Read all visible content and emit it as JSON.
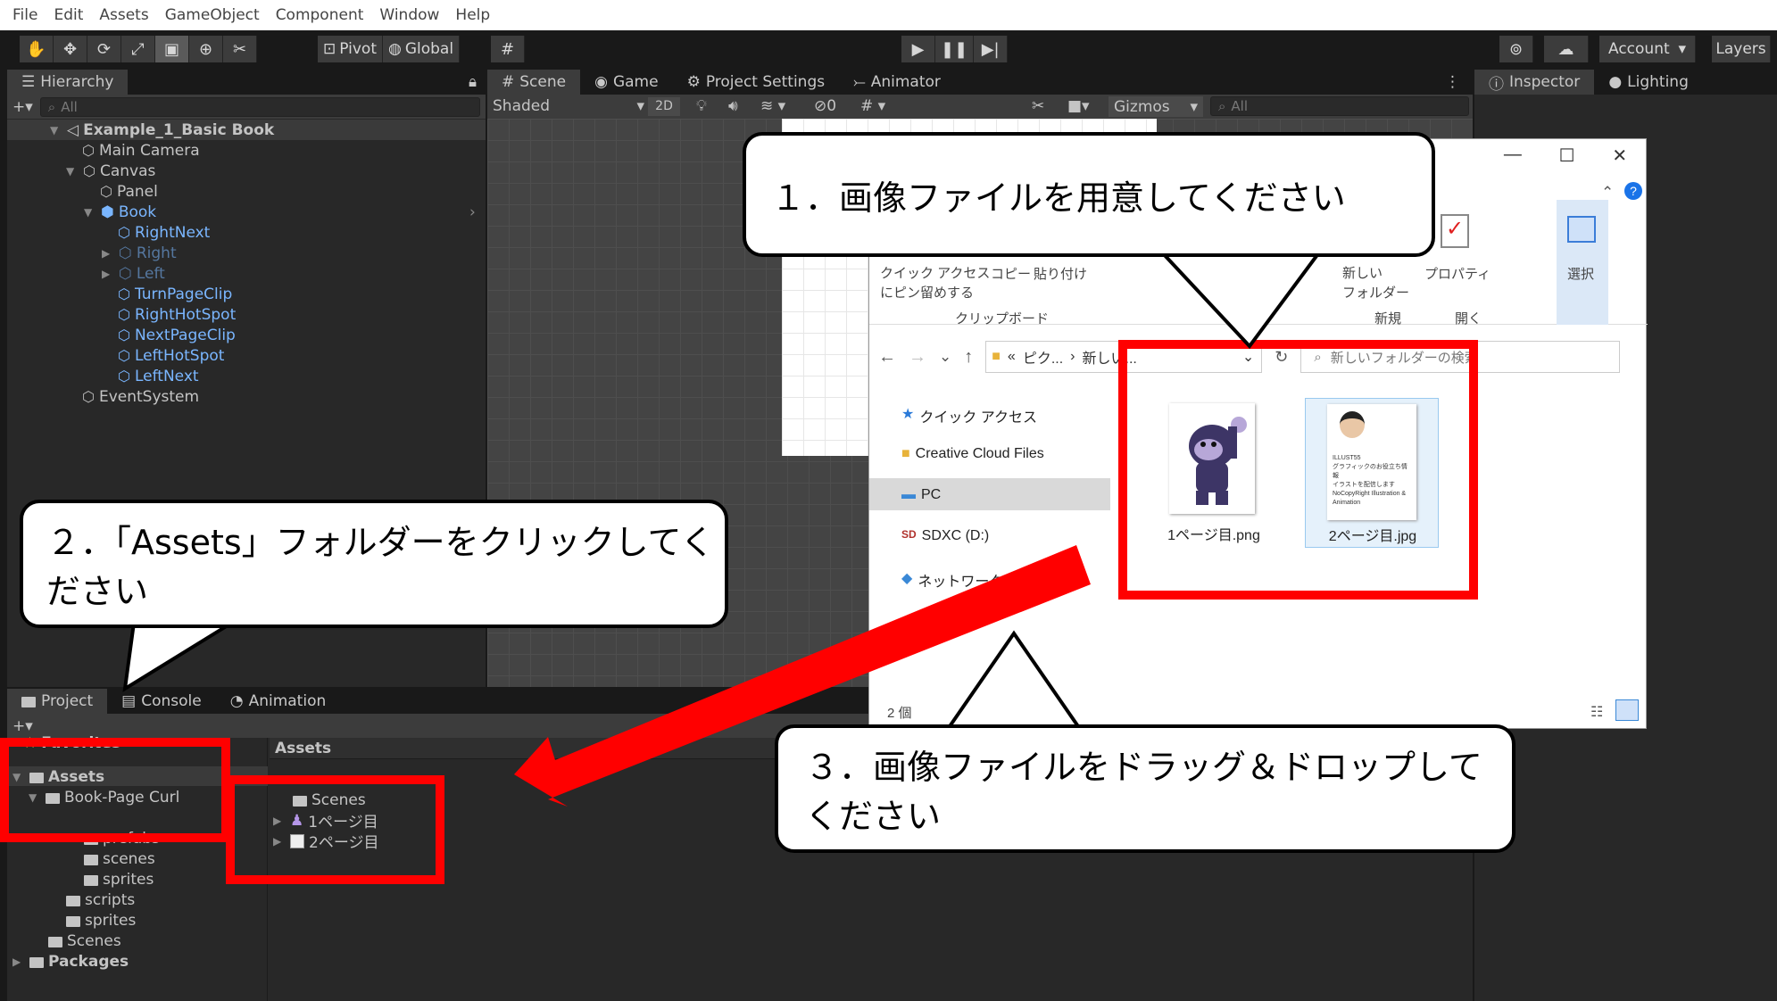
{
  "menu": [
    "File",
    "Edit",
    "Assets",
    "GameObject",
    "Component",
    "Window",
    "Help"
  ],
  "toolbar": {
    "pivot_label": "Pivot",
    "global_label": "Global",
    "account_label": "Account",
    "layers_label": "Layers"
  },
  "hierarchy": {
    "tab_label": "Hierarchy",
    "search_placeholder": "All",
    "scene_name": "Example_1_Basic Book",
    "items": [
      {
        "label": "Main Camera"
      },
      {
        "label": "Canvas"
      },
      {
        "label": "Panel"
      },
      {
        "label": "Book"
      },
      {
        "label": "RightNext"
      },
      {
        "label": "Right"
      },
      {
        "label": "Left"
      },
      {
        "label": "TurnPageClip"
      },
      {
        "label": "RightHotSpot"
      },
      {
        "label": "NextPageClip"
      },
      {
        "label": "LeftHotSpot"
      },
      {
        "label": "LeftNext"
      },
      {
        "label": "EventSystem"
      }
    ]
  },
  "scene": {
    "tabs": [
      "Scene",
      "Game",
      "Project Settings",
      "Animator"
    ],
    "shading_mode": "Shaded",
    "mode_2d": "2D",
    "hidden_count": "0",
    "gizmos_label": "Gizmos",
    "search_placeholder": "All"
  },
  "inspector": {
    "tabs": [
      "Inspector",
      "Lighting"
    ]
  },
  "project": {
    "tabs": [
      "Project",
      "Console",
      "Animation"
    ],
    "tree": [
      {
        "label": "Favorites"
      },
      {
        "label": "Assets"
      },
      {
        "label": "Book-Page Curl"
      },
      {
        "label": "prefabs"
      },
      {
        "label": "scenes"
      },
      {
        "label": "sprites"
      },
      {
        "label": "scripts"
      },
      {
        "label": "sprites"
      },
      {
        "label": "Scenes"
      },
      {
        "label": "Packages"
      }
    ],
    "assets_header": "Assets",
    "assets_items": [
      {
        "label": "Scenes"
      },
      {
        "label": "1ページ目"
      },
      {
        "label": "2ページ目"
      }
    ]
  },
  "explorer": {
    "ribbon": {
      "quick_access_line1": "クイック アクセス",
      "quick_access_line2": "にピン留めする",
      "copy": "コピー",
      "paste": "貼り付け",
      "clipboard_group": "クリップボード",
      "new_folder_line1": "新しい",
      "new_folder_line2": "フォルダー",
      "new_group": "新規",
      "properties": "プロパティ",
      "open_group": "開く",
      "select": "選択"
    },
    "address_prefix": "«",
    "address_seg1": "ピク...",
    "address_seg2": "新しい...",
    "search_placeholder": "新しいフォルダーの検索",
    "nav": [
      {
        "label": "クイック アクセス"
      },
      {
        "label": "Creative Cloud Files"
      },
      {
        "label": "PC"
      },
      {
        "label": "SDXC (D:)"
      },
      {
        "label": "ネットワーク"
      }
    ],
    "files": [
      {
        "name": "1ページ目.png"
      },
      {
        "name": "2ページ目.jpg"
      }
    ],
    "thumb2_lines": [
      "ILLUST55",
      "グラフィックのお役立ち情報",
      "イラストを配信します",
      "NoCopyRight Illustration &",
      "Animation"
    ],
    "status_count": "2 個"
  },
  "callouts": {
    "step1": "１．画像ファイルを用意してください",
    "step2": "２．「Assets」フォルダーをクリックしてください",
    "step3": "３．画像ファイルをドラッグ＆ドロップしてください"
  },
  "colors": {
    "highlight_red": "#ff0000",
    "unity_blue": "#7ab6ff",
    "editor_dark": "#282828"
  }
}
